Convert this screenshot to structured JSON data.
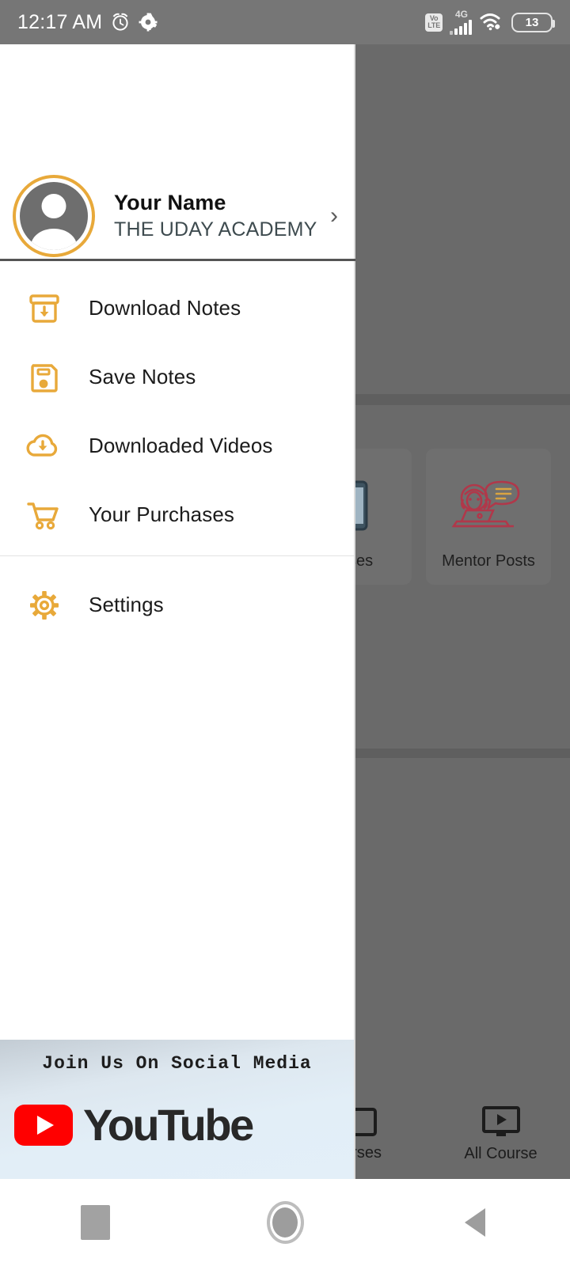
{
  "statusbar": {
    "time": "12:17 AM",
    "alarm_icon": "alarm-clock-icon",
    "settings_icon": "gear-icon",
    "volte_top": "Vo",
    "volte_bottom": "LTE",
    "network_type": "4G",
    "wifi_icon": "wifi-icon",
    "battery_level": "13"
  },
  "drawer": {
    "profile": {
      "name": "Your Name",
      "organization": "THE UDAY ACADEMY",
      "avatar_icon": "person-avatar-icon",
      "chevron": "›"
    },
    "menu_primary": [
      {
        "label": "Download Notes",
        "icon": "archive-download-icon"
      },
      {
        "label": "Save Notes",
        "icon": "floppy-save-icon"
      },
      {
        "label": "Downloaded Videos",
        "icon": "cloud-download-icon"
      },
      {
        "label": "Your Purchases",
        "icon": "shopping-cart-icon"
      }
    ],
    "menu_secondary": [
      {
        "label": "Settings",
        "icon": "gear-icon"
      }
    ],
    "social": {
      "title": "Join Us On Social Media",
      "youtube_label": "YouTube",
      "youtube_icon": "youtube-play-icon"
    }
  },
  "background_app": {
    "cards": [
      {
        "label": "asses",
        "icon": "mobile-classes-icon"
      },
      {
        "label": "Mentor Posts",
        "icon": "mentor-laptop-chat-icon"
      }
    ],
    "bottom_nav": [
      {
        "label": "urses",
        "icon": "book-icon"
      },
      {
        "label": "All Course",
        "icon": "tv-play-icon"
      }
    ]
  },
  "system_nav": {
    "recents": "recents-square-icon",
    "home": "home-circle-icon",
    "back": "back-triangle-icon"
  },
  "colors": {
    "accent": "#e8a93a",
    "scrim": "#6a6a6a",
    "statusbar": "#767676",
    "youtube_red": "#ff0000",
    "card_art": "#b0384a"
  }
}
